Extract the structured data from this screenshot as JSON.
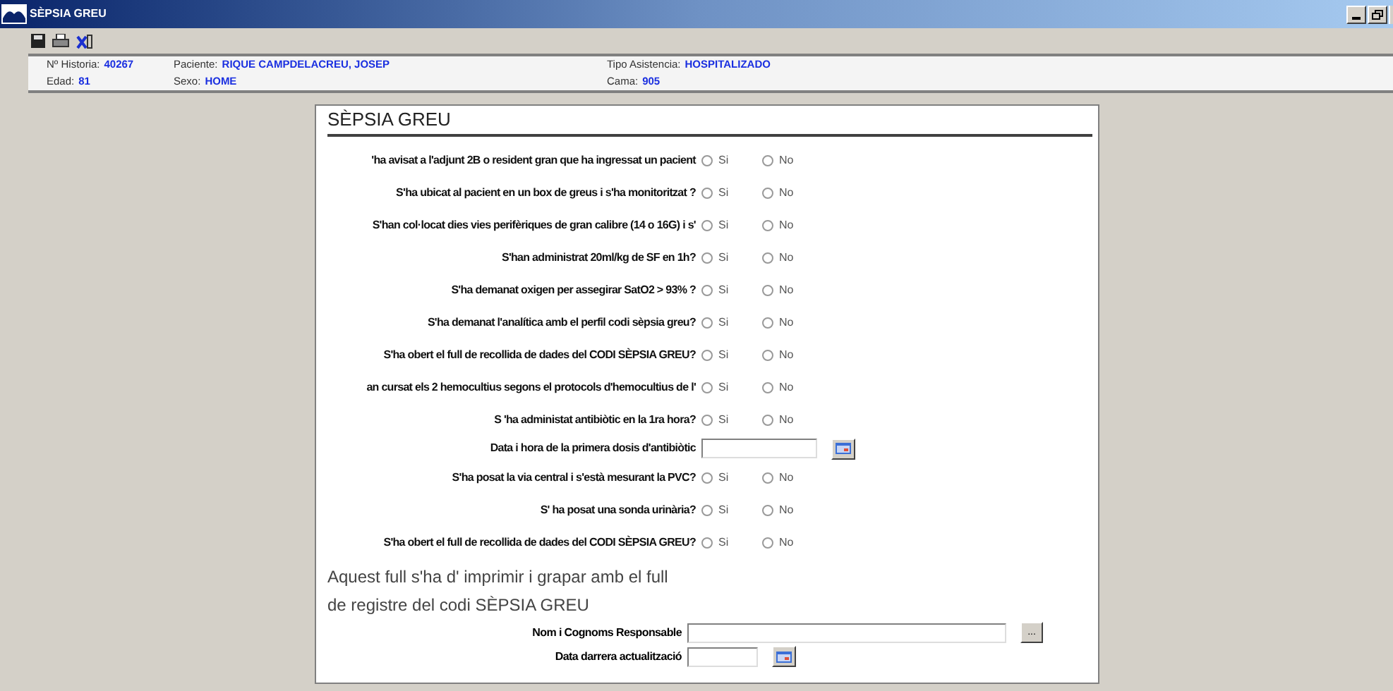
{
  "window": {
    "title": "SÈPSIA GREU"
  },
  "patient": [
    {
      "label": "Nº Historia:",
      "value": "40267"
    },
    {
      "label": "Paciente:",
      "value": "RIQUE CAMPDELACREU, JOSEP"
    },
    {
      "label": "Tipo Asistencia:",
      "value": "HOSPITALIZADO"
    },
    {
      "label": "Edad:",
      "value": "81"
    },
    {
      "label": "Sexo:",
      "value": "HOME"
    },
    {
      "label": "Cama:",
      "value": "905"
    }
  ],
  "form": {
    "title": "SÈPSIA GREU",
    "rows": [
      {
        "kind": "radio",
        "label": "'ha avisat a l'adjunt 2B o resident gran que ha ingressat un pacient",
        "options": [
          {
            "label": "Si",
            "selected": false
          },
          {
            "label": "No",
            "selected": false
          }
        ]
      },
      {
        "kind": "radio",
        "label": "S'ha ubicat al pacient en un box de greus i s'ha monitoritzat ?",
        "options": [
          {
            "label": "Si",
            "selected": false
          },
          {
            "label": "No",
            "selected": false
          }
        ]
      },
      {
        "kind": "radio",
        "label": "S'han col·locat dies vies perifèriques de gran calibre (14 o 16G) i s'",
        "options": [
          {
            "label": "Si",
            "selected": false
          },
          {
            "label": "No",
            "selected": false
          }
        ]
      },
      {
        "kind": "radio",
        "label": "S'han administrat 20ml/kg de SF en 1h?",
        "options": [
          {
            "label": "Si",
            "selected": false
          },
          {
            "label": "No",
            "selected": false
          }
        ]
      },
      {
        "kind": "radio",
        "label": "S'ha demanat oxigen per assegirar SatO2 > 93% ?",
        "options": [
          {
            "label": "Si",
            "selected": false
          },
          {
            "label": "No",
            "selected": false
          }
        ]
      },
      {
        "kind": "radio",
        "label": "S'ha demanat l'analítica amb el perfil codi sèpsia greu?",
        "options": [
          {
            "label": "Si",
            "selected": false
          },
          {
            "label": "No",
            "selected": false
          }
        ]
      },
      {
        "kind": "radio",
        "label": "S'ha obert el full de recollida de dades del CODI SÈPSIA GREU?",
        "options": [
          {
            "label": "Si",
            "selected": false
          },
          {
            "label": "No",
            "selected": false
          }
        ]
      },
      {
        "kind": "radio",
        "label": "an cursat els 2 hemocultius segons el protocols d'hemocultius de l'",
        "options": [
          {
            "label": "Si",
            "selected": false
          },
          {
            "label": "No",
            "selected": false
          }
        ]
      },
      {
        "kind": "radio",
        "label": "S 'ha administat antibiòtic en la 1ra hora?",
        "options": [
          {
            "label": "Si",
            "selected": false
          },
          {
            "label": "No",
            "selected": false
          }
        ]
      },
      {
        "kind": "date",
        "label": "Data i hora de la primera dosis d'antibiòtic"
      },
      {
        "kind": "radio",
        "label": "S'ha posat la via central i s'està mesurant la PVC?",
        "options": [
          {
            "label": "Si",
            "selected": false
          },
          {
            "label": "No",
            "selected": false
          }
        ]
      },
      {
        "kind": "radio",
        "label": "S' ha posat una sonda urinària?",
        "options": [
          {
            "label": "Si",
            "selected": false
          },
          {
            "label": "No",
            "selected": false
          }
        ]
      },
      {
        "kind": "radio",
        "label": "S'ha obert el full de recollida de dades del CODI SÈPSIA GREU?",
        "options": [
          {
            "label": "Si",
            "selected": false
          },
          {
            "label": "No",
            "selected": false
          }
        ]
      }
    ],
    "note": [
      "Aquest full s'ha d' imprimir i grapar amb el full",
      "de registre del codi SÈPSIA GREU"
    ],
    "responsible_label": "Nom i Cognoms Responsable",
    "browse_button": "...",
    "updated_label": "Data darrera actualització"
  }
}
